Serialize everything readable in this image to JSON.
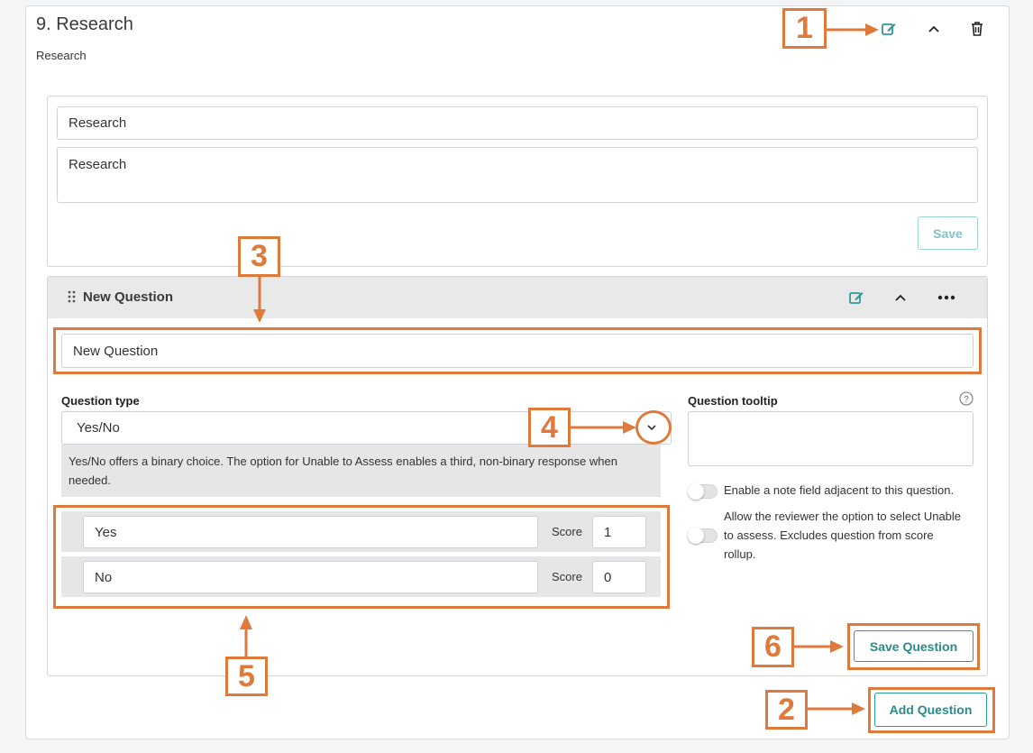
{
  "section": {
    "title": "9. Research",
    "subtitle": "Research",
    "edit_icon": "edit-icon",
    "collapse_icon": "chevron-up-icon",
    "delete_icon": "trash-icon"
  },
  "section_form": {
    "name_value": "Research",
    "description_value": "Research",
    "save_label": "Save"
  },
  "question": {
    "header_title": "New Question",
    "drag_icon": "drag-handle-icon",
    "edit_icon": "edit-icon",
    "collapse_icon": "chevron-up-icon",
    "more_icon": "more-horizontal-icon",
    "title_value": "New Question",
    "type_label": "Question type",
    "type_value": "Yes/No",
    "type_help": "Yes/No offers a binary choice. The option for Unable to Assess enables a third, non-binary response when needed.",
    "tooltip_label": "Question tooltip",
    "tooltip_help_icon": "help-circle-icon",
    "tooltip_value": "",
    "answers": [
      {
        "label": "Yes",
        "score_label": "Score",
        "score": "1"
      },
      {
        "label": "No",
        "score_label": "Score",
        "score": "0"
      }
    ],
    "note_toggle_label": "Enable a note field adjacent to this question.",
    "unable_toggle_label": "Allow the reviewer the option to select Unable to assess. Excludes question from score rollup.",
    "save_label": "Save Question"
  },
  "add_question_label": "Add Question",
  "callouts": [
    "1",
    "2",
    "3",
    "4",
    "5",
    "6"
  ],
  "colors": {
    "accent_teal": "#2b9b9b",
    "callout_orange": "#e07a3a",
    "header_gray": "#e9e9ea"
  }
}
